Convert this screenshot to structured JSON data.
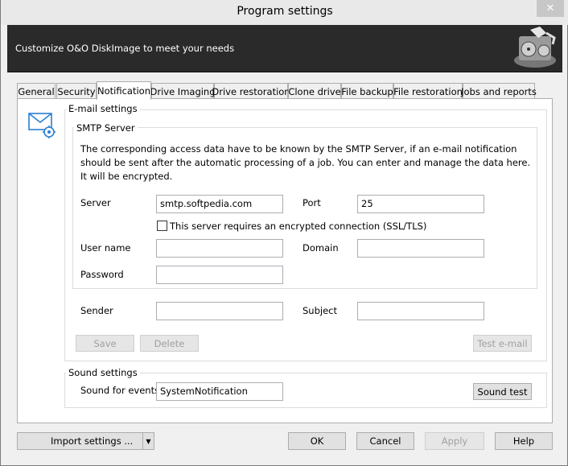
{
  "window": {
    "title": "Program settings",
    "close_glyph": "✕"
  },
  "banner": {
    "text": "Customize O&O DiskImage to meet your needs",
    "logo_icon": "diskimage-logo-icon"
  },
  "tabs": [
    {
      "label": "General"
    },
    {
      "label": "Security"
    },
    {
      "label": "Notification",
      "active": true
    },
    {
      "label": "Drive Imaging"
    },
    {
      "label": "Drive restoration"
    },
    {
      "label": "Clone drive"
    },
    {
      "label": "File backup"
    },
    {
      "label": "File restoration"
    },
    {
      "label": "Jobs and reports"
    }
  ],
  "email": {
    "group_label": "E-mail settings",
    "icon": "email-settings-icon",
    "smtp": {
      "group_label": "SMTP Server",
      "description": "The corresponding access data have to be known by the SMTP Server, if an e-mail notification should be sent after the automatic processing of a job. You can enter and manage the data here. It will be encrypted.",
      "server_label": "Server",
      "server_value": "smtp.softpedia.com",
      "port_label": "Port",
      "port_value": "25",
      "ssl_label": "This server requires an encrypted connection (SSL/TLS)",
      "ssl_checked": false,
      "username_label": "User name",
      "username_value": "",
      "domain_label": "Domain",
      "domain_value": "",
      "password_label": "Password",
      "password_value": ""
    },
    "sender_label": "Sender",
    "sender_value": "",
    "subject_label": "Subject",
    "subject_value": "",
    "save_label": "Save",
    "delete_label": "Delete",
    "test_label": "Test e-mail"
  },
  "sound": {
    "group_label": "Sound settings",
    "events_label": "Sound for events",
    "events_value": "SystemNotification",
    "test_label": "Sound test"
  },
  "footer": {
    "import_label": "Import settings ...",
    "ok_label": "OK",
    "cancel_label": "Cancel",
    "apply_label": "Apply",
    "help_label": "Help"
  }
}
